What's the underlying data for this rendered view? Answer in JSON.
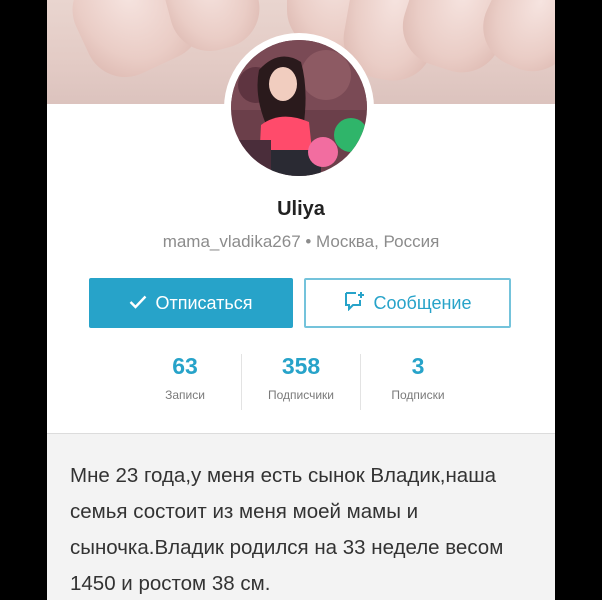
{
  "profile": {
    "name": "Uliya",
    "meta": "mama_vladika267 • Москва, Россия"
  },
  "actions": {
    "unsubscribe_label": "Отписаться",
    "message_label": "Сообщение"
  },
  "stats": [
    {
      "value": "63",
      "label": "Записи"
    },
    {
      "value": "358",
      "label": "Подписчики"
    },
    {
      "value": "3",
      "label": "Подписки"
    }
  ],
  "bio": "Мне 23 года,у меня есть сынок Владик,наша семья состоит из меня моей мамы и сыночка.Владик родился на 33 неделе весом 1450 и ростом 38 см.",
  "colors": {
    "accent": "#27a3c9",
    "text": "#222222",
    "muted": "#8c8c8c"
  }
}
